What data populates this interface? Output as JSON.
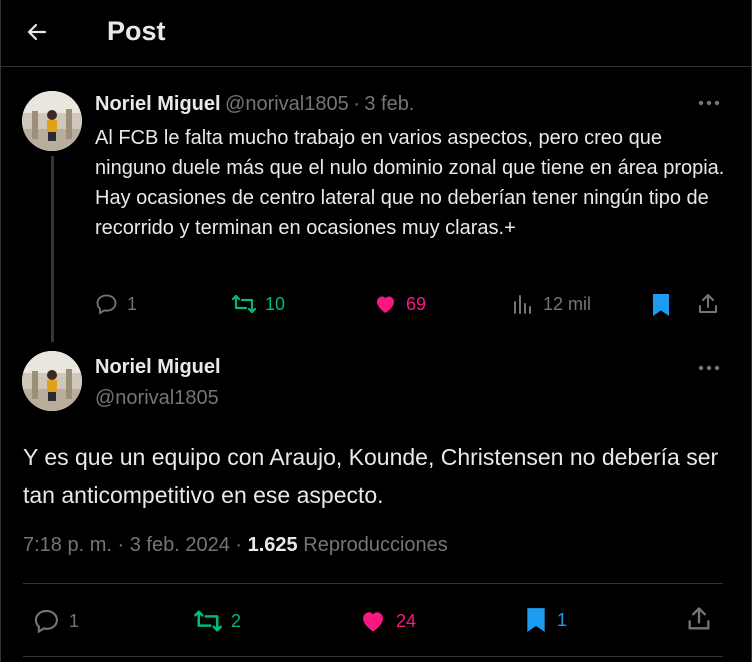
{
  "header": {
    "title": "Post"
  },
  "quoted": {
    "author_name": "Noriel Miguel",
    "handle": "@norival1805",
    "separator": "·",
    "date": "3 feb.",
    "text": "Al FCB le falta mucho trabajo en varios aspectos, pero creo que ninguno duele más que el nulo dominio zonal que tiene en área propia. Hay ocasiones de centro lateral que no deberían tener ningún tipo de recorrido y terminan en ocasiones muy claras.+",
    "replies": "1",
    "reposts": "10",
    "likes": "69",
    "views": "12 mil"
  },
  "main": {
    "author_name": "Noriel Miguel",
    "handle": "@norival1805",
    "text": "Y es que un equipo con Araujo, Kounde, Christensen no debería ser tan anticompetitivo en ese aspecto.",
    "time": "7:18 p. m.",
    "sep1": "·",
    "date": "3 feb. 2024",
    "sep2": "·",
    "views_count": "1.625",
    "views_label": "Reproducciones",
    "replies": "1",
    "reposts": "2",
    "likes": "24",
    "bookmarks": "1"
  },
  "colors": {
    "repost": "#00ba7c",
    "like": "#f91880",
    "bookmark": "#1d9bf0",
    "muted": "#71767b"
  },
  "icons": [
    "back-arrow-icon",
    "more-icon",
    "reply-icon",
    "repost-icon",
    "heart-icon",
    "views-icon",
    "bookmark-icon",
    "share-icon"
  ]
}
